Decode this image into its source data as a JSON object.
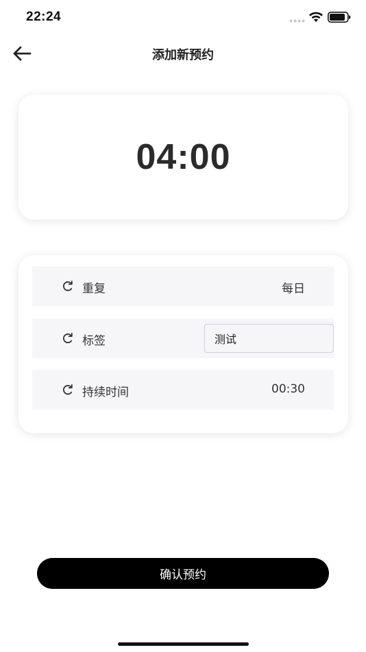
{
  "status_bar": {
    "time": "22:24",
    "icons": [
      "signal-icon",
      "wifi-icon",
      "battery-icon"
    ]
  },
  "header": {
    "title": "添加新预约",
    "back_icon": "arrow-left-icon"
  },
  "time_card": {
    "time": "04:00"
  },
  "settings": {
    "repeat": {
      "icon": "refresh-icon",
      "label": "重复",
      "value": "每日"
    },
    "tag": {
      "icon": "refresh-icon",
      "label": "标签",
      "value": "测试"
    },
    "duration": {
      "icon": "refresh-icon",
      "label": "持续时间",
      "value": "00:30"
    }
  },
  "confirm": {
    "label": "确认预约"
  },
  "colors": {
    "row_background": "#f6f6f9",
    "button_background": "#000000",
    "button_text": "#ffffff",
    "text_primary": "#222222"
  }
}
